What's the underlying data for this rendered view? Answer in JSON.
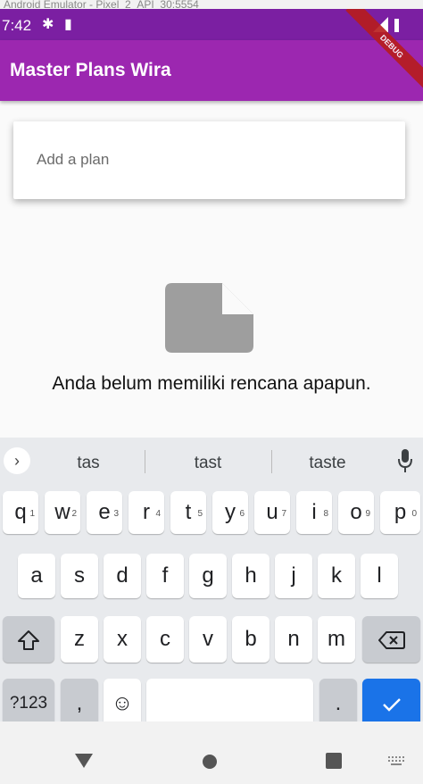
{
  "emulator": {
    "title": "Android Emulator - Pixel_2_API_30:5554"
  },
  "status": {
    "time": "7:42",
    "debug_label": "DEBUG"
  },
  "appbar": {
    "title": "Master Plans Wira",
    "color": "#9c27b0"
  },
  "input": {
    "placeholder": "Add a plan",
    "value": ""
  },
  "empty_state": {
    "icon": "note-icon",
    "message": "Anda belum memiliki rencana apapun."
  },
  "keyboard": {
    "suggestions": [
      "tas",
      "tast",
      "taste"
    ],
    "row1": [
      "q",
      "w",
      "e",
      "r",
      "t",
      "y",
      "u",
      "i",
      "o",
      "p"
    ],
    "row1_hints": [
      "1",
      "2",
      "3",
      "4",
      "5",
      "6",
      "7",
      "8",
      "9",
      "0"
    ],
    "row2": [
      "a",
      "s",
      "d",
      "f",
      "g",
      "h",
      "j",
      "k",
      "l"
    ],
    "row3": [
      "z",
      "x",
      "c",
      "v",
      "b",
      "n",
      "m"
    ],
    "symbols_label": "?123",
    "comma": ",",
    "period": ".",
    "enter_color": "#1a73e8"
  }
}
